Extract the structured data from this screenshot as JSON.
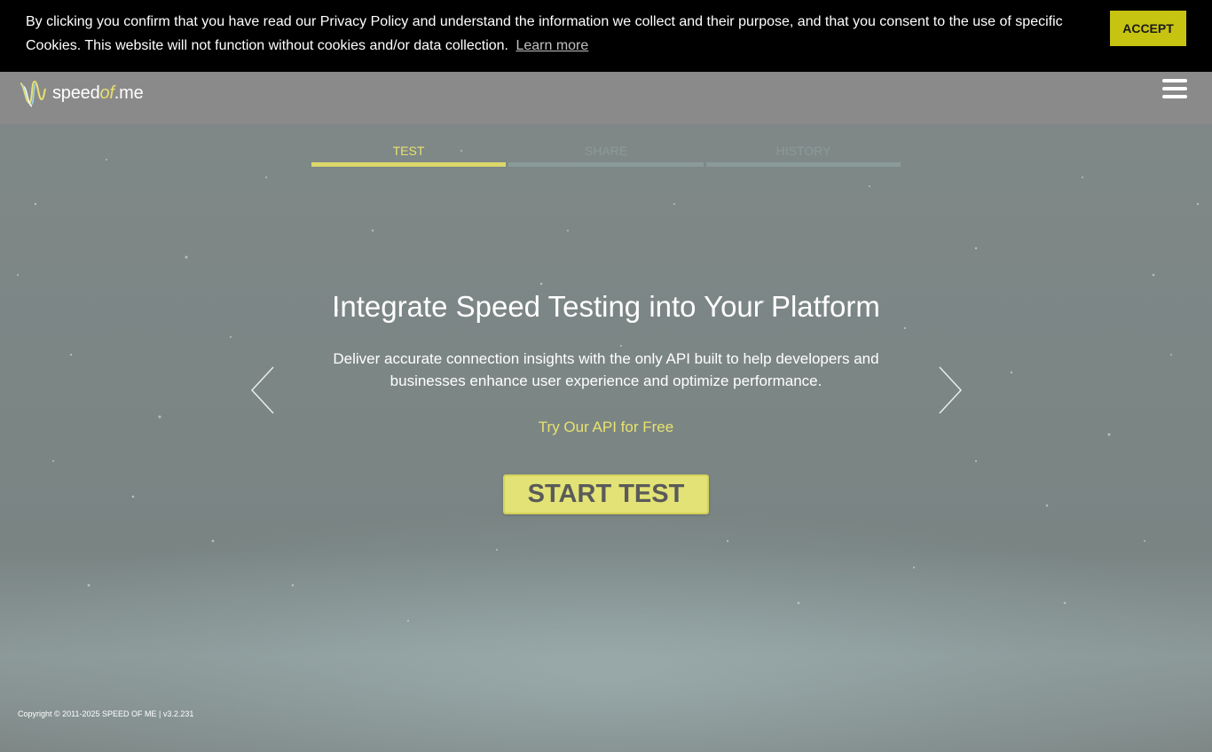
{
  "cookie_banner": {
    "text": "By clicking you confirm that you have read our Privacy Policy and understand the information we collect and their purpose, and that you consent to the use of specific Cookies. This website will not function without cookies and/or data collection.",
    "learn_more": "Learn more",
    "accept_label": "ACCEPT"
  },
  "header": {
    "logo": {
      "speed": "speed",
      "of": "of",
      "me": ".me"
    },
    "menu_icon": "hamburger-icon"
  },
  "tabs": [
    {
      "label": "TEST",
      "active": true
    },
    {
      "label": "SHARE",
      "active": false
    },
    {
      "label": "HISTORY",
      "active": false
    }
  ],
  "carousel": {
    "title": "Integrate Speed Testing into Your Platform",
    "description": "Deliver accurate connection insights with the only API built to help developers and businesses enhance user experience and optimize performance.",
    "link": "Try Our API for Free",
    "prev_icon": "chevron-left-icon",
    "next_icon": "chevron-right-icon"
  },
  "start_button": {
    "label": "START TEST"
  },
  "footer": {
    "copyright": "Copyright © 2011-2025 SPEED OF ME | v3.2.231"
  },
  "colors": {
    "accent": "#e8e26e",
    "accept_button": "#c7c311",
    "cookie_bg": "#000000",
    "inactive_tab": "#8a9a98"
  }
}
